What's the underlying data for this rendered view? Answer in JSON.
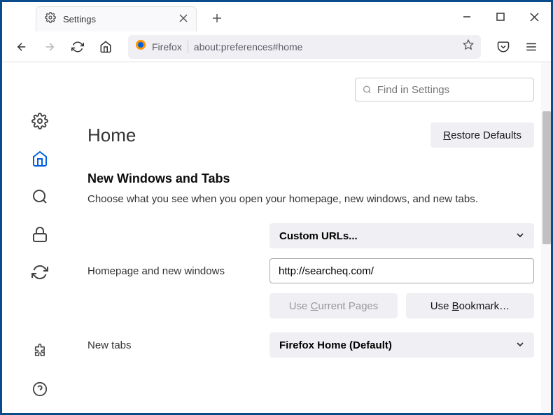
{
  "window": {
    "tab_title": "Settings"
  },
  "toolbar": {
    "address_label": "Firefox",
    "address_url": "about:preferences#home"
  },
  "search": {
    "placeholder": "Find in Settings"
  },
  "page": {
    "title": "Home",
    "restore_defaults": "Restore Defaults"
  },
  "section": {
    "title": "New Windows and Tabs",
    "description": "Choose what you see when you open your homepage, new windows, and new tabs."
  },
  "homepage": {
    "label": "Homepage and new windows",
    "dropdown_value": "Custom URLs...",
    "url_value": "http://searcheq.com/",
    "use_current": "Use Current Pages",
    "use_bookmark": "Use Bookmark…"
  },
  "newtabs": {
    "label": "New tabs",
    "dropdown_value": "Firefox Home (Default)"
  }
}
